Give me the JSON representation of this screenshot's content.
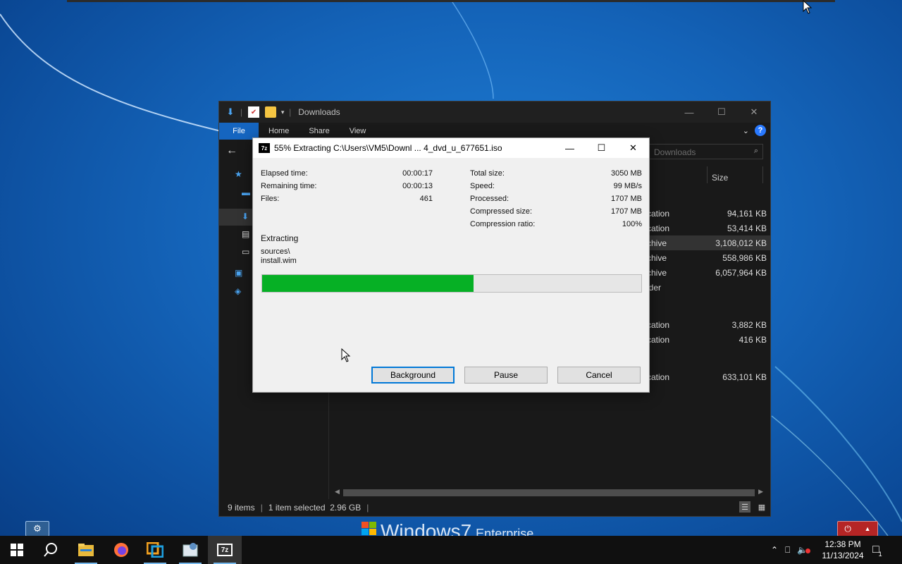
{
  "explorer": {
    "title": "Downloads",
    "ribbon_tabs": [
      "File",
      "Home",
      "Share",
      "View"
    ],
    "search_placeholder": "Downloads",
    "columns": {
      "size": "Size"
    },
    "rows": [
      {
        "type": "cation",
        "size": "94,161 KB"
      },
      {
        "type": "cation",
        "size": "53,414 KB"
      },
      {
        "type": "chive",
        "size": "3,108,012 KB",
        "selected": true
      },
      {
        "type": "chive",
        "size": "558,986 KB"
      },
      {
        "type": "chive",
        "size": "6,057,964 KB"
      },
      {
        "type": "lder",
        "size": ""
      },
      {
        "type": "cation",
        "size": "3,882 KB"
      },
      {
        "type": "cation",
        "size": "416 KB"
      },
      {
        "type": "cation",
        "size": "633,101 KB"
      }
    ],
    "status": {
      "items": "9 items",
      "selected": "1 item selected  2.96 GB"
    }
  },
  "dialog": {
    "app_icon_text": "7z",
    "title": "55% Extracting C:\\Users\\VM5\\Downl ... 4_dvd_u_677651.iso",
    "progress_fraction": 0.557,
    "stats_left": [
      {
        "label": "Elapsed time:",
        "value": "00:00:17"
      },
      {
        "label": "Remaining time:",
        "value": "00:00:13"
      },
      {
        "label": "Files:",
        "value": "461"
      }
    ],
    "stats_right": [
      {
        "label": "Total size:",
        "value": "3050 MB"
      },
      {
        "label": "Speed:",
        "value": "99 MB/s"
      },
      {
        "label": "Processed:",
        "value": "1707 MB"
      },
      {
        "label": "Compressed size:",
        "value": "1707 MB"
      },
      {
        "label": "Compression ratio:",
        "value": "100%"
      }
    ],
    "operation": "Extracting",
    "path_line1": "sources\\",
    "path_line2": "install.wim",
    "buttons": {
      "background": "Background",
      "pause": "Pause",
      "cancel": "Cancel"
    }
  },
  "desktop": {
    "logo_text": "Windows",
    "logo_version": "7",
    "logo_edition": "Enterprise"
  },
  "taskbar": {
    "pinned": [
      "start-icon",
      "search-icon",
      "file-explorer-icon",
      "firefox-icon",
      "app-icon",
      "control-panel-icon",
      "7zip-icon"
    ],
    "clock_time": "12:38 PM",
    "clock_date": "11/13/2024",
    "notification_count": "1"
  },
  "colors": {
    "progress_fill": "#06b025",
    "accent": "#0078d7",
    "ribbon_file": "#1565c0"
  }
}
